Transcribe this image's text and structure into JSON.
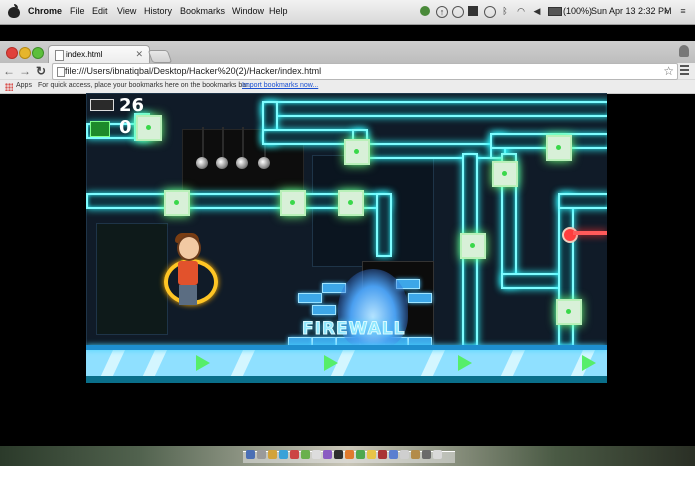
{
  "menubar": {
    "app_name": "Chrome",
    "menus": [
      "File",
      "Edit",
      "View",
      "History",
      "Bookmarks",
      "Window",
      "Help"
    ],
    "battery": "(100%)",
    "datetime": "Sun Apr 13  2:32 PM"
  },
  "browser": {
    "tab_title": "index.html",
    "url": "file:///Users/ibnatiqbal/Desktop/Hacker%20(2)/Hacker/index.html"
  },
  "bookmarks_bar": {
    "apps_label": "Apps",
    "hint": "For quick access, place your bookmarks here on the bookmarks bar.",
    "import_link": "Import bookmarks now..."
  },
  "game": {
    "score": "26",
    "secondary_counter": "0",
    "wall_label": "FIREWALL",
    "colors": {
      "pipe_glow": "#7efcff",
      "node_green": "#39d84a",
      "hero_ring": "#ffc524",
      "laser": "#ff4040",
      "floor": "#8fe0ff"
    }
  },
  "icons": [
    "apple-icon",
    "wifi-icon",
    "volume-icon",
    "battery-icon",
    "search-icon",
    "list-icon",
    "back-icon",
    "forward-icon",
    "reload-icon",
    "star-icon",
    "menu-icon",
    "apps-icon"
  ]
}
